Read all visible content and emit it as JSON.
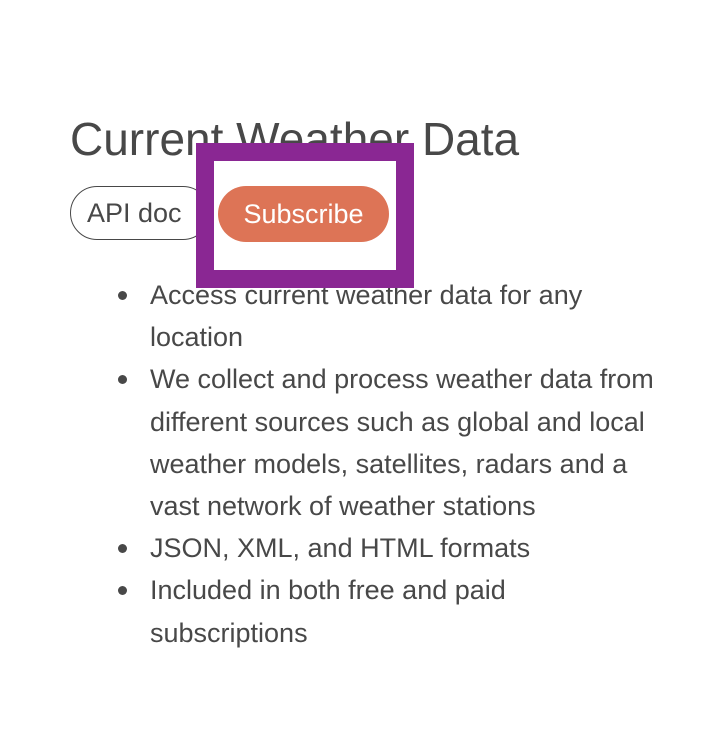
{
  "page": {
    "title": "Current Weather Data"
  },
  "buttons": {
    "api_doc_label": "API doc",
    "subscribe_label": "Subscribe"
  },
  "colors": {
    "text": "#484848",
    "subscribe_bg": "#dd7456",
    "highlight_frame": "#8a2793"
  },
  "features": [
    "Access current weather data for any location",
    "We collect and process weather data from different sources such as global and local weather models, satellites, radars and a vast network of weather stations",
    "JSON, XML, and HTML formats",
    "Included in both free and paid subscriptions"
  ]
}
